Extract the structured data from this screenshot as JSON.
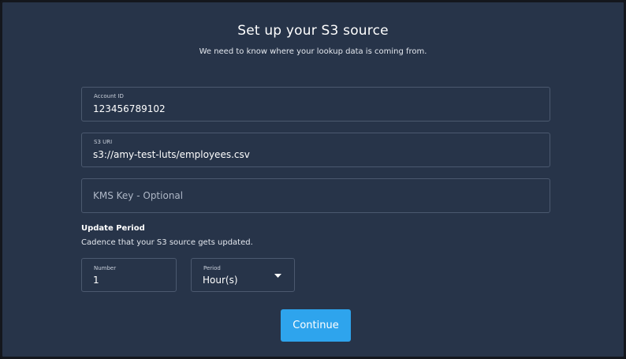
{
  "header": {
    "title": "Set up your S3 source",
    "subtitle": "We need to know where your lookup data is coming from."
  },
  "fields": {
    "account_id": {
      "label": "Account ID",
      "value": "123456789102"
    },
    "s3_uri": {
      "label": "S3 URI",
      "value": "s3://amy-test-luts/employees.csv"
    },
    "kms_key": {
      "placeholder": "KMS Key - Optional",
      "value": ""
    }
  },
  "update_period": {
    "title": "Update Period",
    "description": "Cadence that your S3 source gets updated.",
    "number": {
      "label": "Number",
      "value": "1"
    },
    "period": {
      "label": "Period",
      "value": "Hour(s)"
    }
  },
  "actions": {
    "continue_label": "Continue"
  },
  "icons": {
    "increment": "triangle-up-icon",
    "decrement": "triangle-down-icon",
    "period_dropdown": "caret-down-icon"
  },
  "colors": {
    "background": "#273449",
    "field_border": "#4b596f",
    "accent": "#2ea4ed",
    "text": "#ffffff"
  }
}
